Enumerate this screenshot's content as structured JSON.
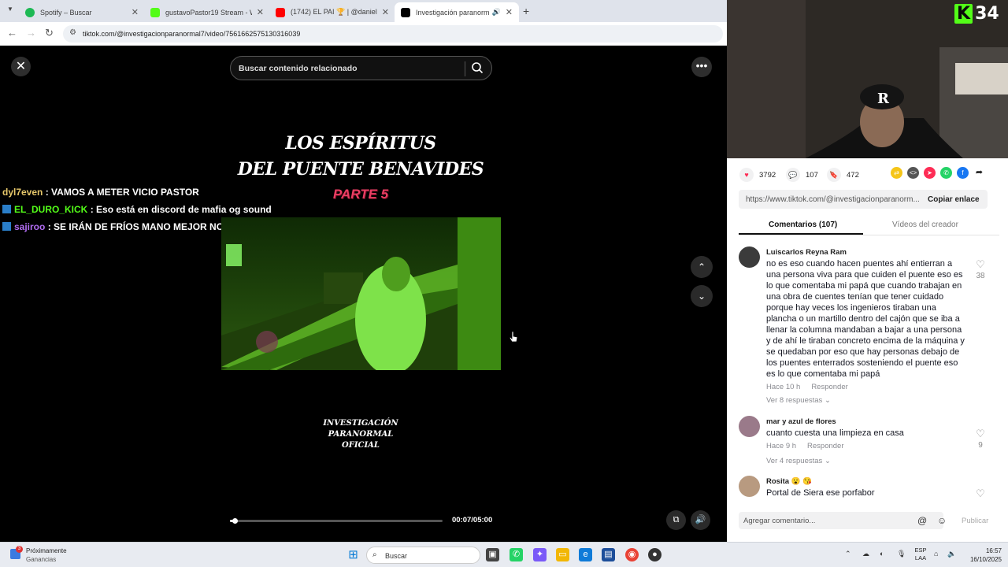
{
  "browser": {
    "tabs": [
      {
        "title": "Spotify – Buscar",
        "color": "#1db954",
        "close": "✕"
      },
      {
        "title": "gustavoPastor19 Stream - Watc",
        "color": "#53fc18",
        "close": "✕"
      },
      {
        "title": "(1742) EL PAI 🏆 | @daniel.leyt",
        "color": "#ff0000",
        "close": "✕"
      },
      {
        "title": "Investigación paranormal p",
        "color": "#000000",
        "close": "✕"
      }
    ],
    "new_tab": "+",
    "url": "tiktok.com/@investigacionparanormal7/video/7561662575130316039"
  },
  "player": {
    "search_placeholder": "Buscar contenido relacionado",
    "video_title_line1": "LOS ESPÍRITUS",
    "video_title_line2": "DEL PUENTE BENAVIDES",
    "video_part": "PARTE 5",
    "watermark": [
      "INVESTIGACIÓN",
      "PARANORMAL",
      "OFICIAL"
    ],
    "time": "00:07/05:00",
    "progress": 0.023
  },
  "chat": [
    {
      "user": "dyl7even",
      "sep": " : ",
      "message": "VAMOS A METER VICIO PASTOR",
      "color": "#e6c76a",
      "badge": false
    },
    {
      "user": "EL_DURO_KICK",
      "sep": " : ",
      "message": "Eso está en discord de mafia og sound",
      "color": "#53fc18",
      "badge": true
    },
    {
      "user": "sajiroo",
      "sep": " : ",
      "message": "SE IRÁN DE FRÍOS MANO MEJOR NO",
      "color": "#b06cf0",
      "badge": true
    }
  ],
  "stream_overlay": {
    "brand_letter": "K",
    "number": "34"
  },
  "stats": {
    "likes": "3792",
    "comments": "107",
    "saves": "472"
  },
  "share": {
    "link": "https://www.tiktok.com/@investigacionparanorm...",
    "copy_label": "Copiar enlace"
  },
  "panel_tabs": {
    "comments": "Comentarios (107)",
    "creator_videos": "Vídeos del creador"
  },
  "comments": [
    {
      "user": "Luiscarlos Reyna Ram",
      "text": "no es eso cuando hacen puentes ahí entierran a una persona viva para que cuiden el puente eso es lo que comentaba mi papá que cuando trabajan en una obra de cuentes tenían que tener cuidado porque hay veces los ingenieros tiraban una plancha o un martillo dentro del cajón que se iba a llenar la columna mandaban a bajar a una persona y de ahí le tiraban concreto encima de la máquina y se quedaban por eso que hay personas debajo de los puentes enterrados sosteniendo el puente eso es lo que comentaba mi papá",
      "time": "Hace 10 h",
      "reply": "Responder",
      "replies": "Ver 8 respuestas",
      "likes": "38"
    },
    {
      "user": "mar y azul de flores",
      "text": "cuanto cuesta una limpieza en casa",
      "time": "Hace 9 h",
      "reply": "Responder",
      "replies": "Ver 4 respuestas",
      "likes": "9"
    },
    {
      "user": "Rosita 😮 😘",
      "text": "Portal de Siera ese porfabor",
      "time": "",
      "reply": "",
      "replies": "",
      "likes": ""
    }
  ],
  "add_comment": {
    "placeholder": "Agregar comentario...",
    "publish": "Publicar"
  },
  "taskbar": {
    "weather_line1": "Próximamente",
    "weather_line2": "Ganancias",
    "notification_count": "3",
    "search_label": "Buscar",
    "lang_line1": "ESP",
    "lang_line2": "LAA",
    "clock_time": "16:57",
    "clock_date": "16/10/2025"
  }
}
